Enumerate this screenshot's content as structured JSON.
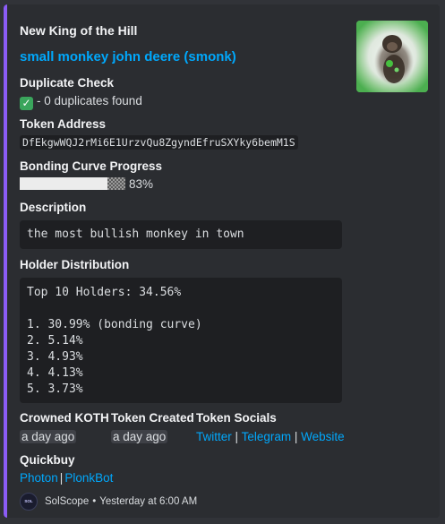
{
  "embed": {
    "accent_color": "#8b5cf6",
    "author": "New King of the Hill",
    "title": "small monkey john deere (smonk)",
    "thumbnail": {
      "icon": "monkey-avatar-image"
    }
  },
  "fields": {
    "duplicate_check": {
      "name": "Duplicate Check",
      "icon": "check-mark-icon",
      "value": "- 0 duplicates found"
    },
    "token_address": {
      "name": "Token Address",
      "value": "DfEkgwWQJ2rMi6E1UrzvQu8ZgyndEfruSXYky6bemM1S"
    },
    "bonding_curve": {
      "name": "Bonding Curve Progress",
      "progress_percent": 83,
      "value": "83%"
    },
    "description": {
      "name": "Description",
      "value": "the most bullish monkey in town"
    },
    "holder_distribution": {
      "name": "Holder Distribution",
      "value": "Top 10 Holders: 34.56%\n\n1. 30.99% (bonding curve)\n2. 5.14%\n3. 4.93%\n4. 4.13%\n5. 3.73%"
    },
    "crowned_koth": {
      "name": "Crowned KOTH",
      "value": "a day ago"
    },
    "token_created": {
      "name": "Token Created",
      "value": "a day ago"
    },
    "token_socials": {
      "name": "Token Socials",
      "links": [
        "Twitter",
        "Telegram",
        "Website"
      ],
      "separator": "|"
    },
    "quickbuy": {
      "name": "Quickbuy",
      "links": [
        "Photon",
        "PlonkBot"
      ],
      "separator": "|"
    }
  },
  "footer": {
    "icon_label": "SOL",
    "text": "SolScope",
    "dot": "•",
    "timestamp": "Yesterday at 6:00 AM"
  },
  "colors": {
    "background": "#313338",
    "embed_background": "#2b2d31",
    "link": "#00a8fc",
    "code_background": "#1e1f22"
  }
}
